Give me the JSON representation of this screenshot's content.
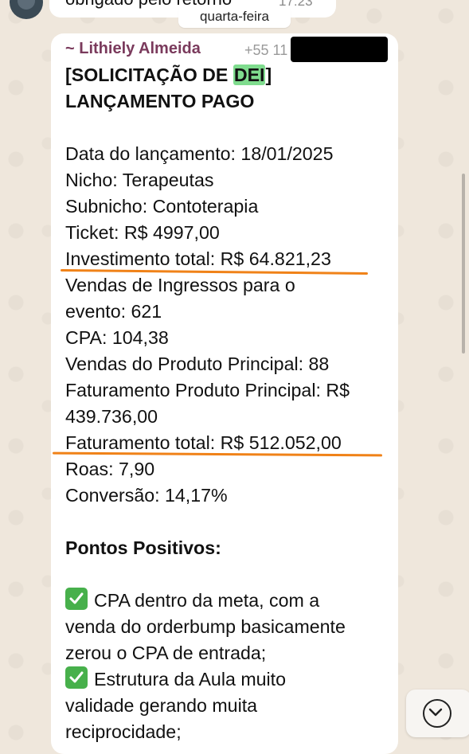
{
  "previous_message": {
    "text": "obrigado pelo retorno",
    "time": "17:23"
  },
  "date_separator": "quarta-feira",
  "sender": {
    "name": "~ Lithiely Almeida",
    "phone_partial": "+55 11"
  },
  "message": {
    "title_prefix": "[SOLICITAÇÃO DE ",
    "title_highlight": "DEI",
    "title_suffix": "]",
    "subtitle": "LANÇAMENTO PAGO",
    "lines": [
      "Data do lançamento: 18/01/2025",
      "Nicho: Terapeutas",
      "Subnicho: Contoterapia",
      "Ticket: R$ 4997,00",
      "Investimento total: R$ 64.821,23",
      "Vendas de Ingressos para o",
      "evento: 621",
      "CPA: 104,38",
      "Vendas do Produto Principal: 88",
      "Faturamento Produto Principal: R$",
      "439.736,00",
      "Faturamento total: R$ 512.052,00",
      "Roas: 7,90",
      "Conversão: 14,17%"
    ],
    "section_title": "Pontos Positivos:",
    "positives": [
      {
        "icon": "check-mark-icon",
        "lines": [
          "CPA dentro da meta, com a",
          "venda do orderbump basicamente",
          "zerou o CPA de entrada;"
        ]
      },
      {
        "icon": "check-mark-icon",
        "lines": [
          "Estrutura da Aula muito",
          "validade gerando muita",
          "reciprocidade;"
        ]
      }
    ]
  },
  "colors": {
    "sender_name": "#7a3a5c",
    "highlight": "#7fdc8e",
    "annotation_underline": "#f08218",
    "check_icon": "#47b04b"
  }
}
